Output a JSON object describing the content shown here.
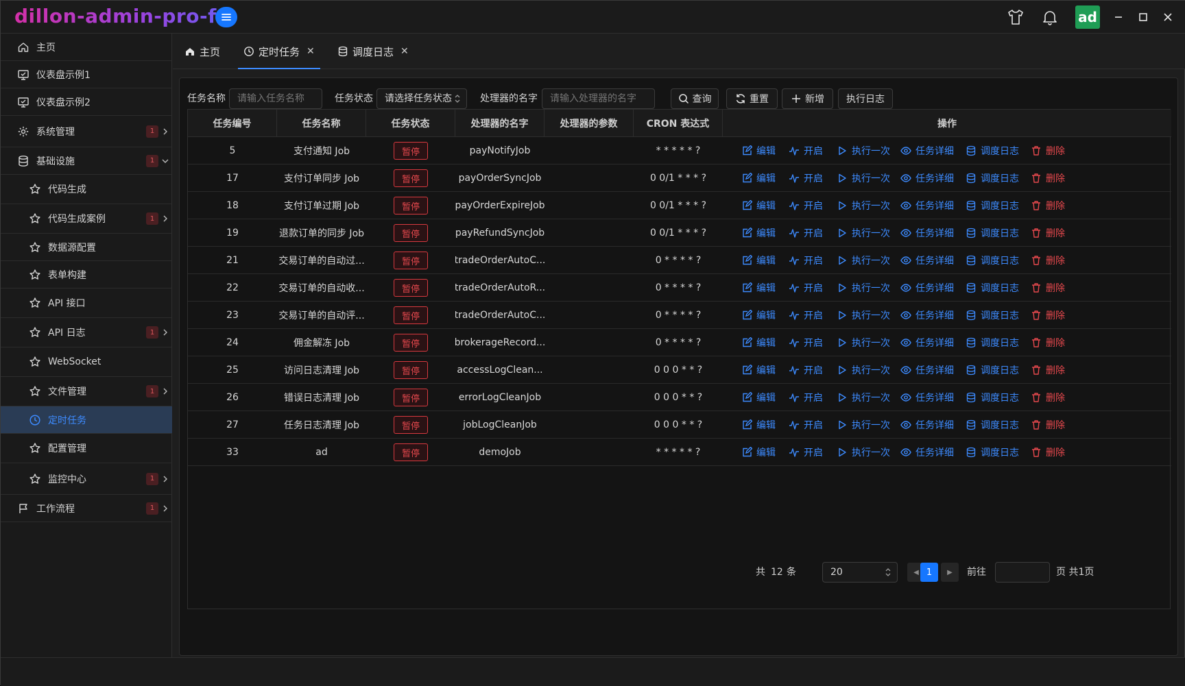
{
  "app": {
    "title": "dillon-admin-pro-fx",
    "avatar_text": "ad"
  },
  "icons": {
    "menu_toggle": "menu-icon",
    "theme": "shirt-icon",
    "notifications": "bell-icon",
    "minimize": "minimize-icon",
    "maximize": "maximize-icon",
    "close": "close-icon"
  },
  "sidebar": {
    "items": [
      {
        "label": "主页",
        "icon": "home-icon",
        "level": 1
      },
      {
        "label": "仪表盘示例1",
        "icon": "monitor-icon",
        "level": 1
      },
      {
        "label": "仪表盘示例2",
        "icon": "monitor-icon",
        "level": 1
      },
      {
        "label": "系统管理",
        "icon": "gear-icon",
        "level": 1,
        "badge": "1",
        "arrow": "right"
      },
      {
        "label": "基础设施",
        "icon": "database-icon",
        "level": 1,
        "badge": "1",
        "arrow": "down"
      },
      {
        "label": "代码生成",
        "icon": "star-icon",
        "level": 2
      },
      {
        "label": "代码生成案例",
        "icon": "star-icon",
        "level": 2,
        "badge": "1",
        "arrow": "right"
      },
      {
        "label": "数据源配置",
        "icon": "star-icon",
        "level": 2
      },
      {
        "label": "表单构建",
        "icon": "star-icon",
        "level": 2
      },
      {
        "label": "API 接口",
        "icon": "star-icon",
        "level": 2
      },
      {
        "label": "API 日志",
        "icon": "star-icon",
        "level": 2,
        "badge": "1",
        "arrow": "right"
      },
      {
        "label": "WebSocket",
        "icon": "star-icon",
        "level": 2
      },
      {
        "label": "文件管理",
        "icon": "star-icon",
        "level": 2,
        "badge": "1",
        "arrow": "right"
      },
      {
        "label": "定时任务",
        "icon": "clock-icon",
        "level": 2,
        "active": true
      },
      {
        "label": "配置管理",
        "icon": "star-icon",
        "level": 2
      },
      {
        "label": "监控中心",
        "icon": "star-icon",
        "level": 2,
        "badge": "1",
        "arrow": "right"
      },
      {
        "label": "工作流程",
        "icon": "flag-icon",
        "level": 1,
        "badge": "1",
        "arrow": "right"
      }
    ]
  },
  "tabs": [
    {
      "label": "主页",
      "icon": "home-icon",
      "closable": false
    },
    {
      "label": "定时任务",
      "icon": "clock-icon",
      "closable": true,
      "active": true
    },
    {
      "label": "调度日志",
      "icon": "database-icon",
      "closable": true
    }
  ],
  "filters": {
    "task_name_label": "任务名称",
    "task_name_placeholder": "请输入任务名称",
    "task_status_label": "任务状态",
    "task_status_value": "请选择任务状态",
    "handler_label": "处理器的名字",
    "handler_placeholder": "请输入处理器的名字",
    "search_label": "查询",
    "reset_label": "重置",
    "add_label": "新增",
    "exec_log_label": "执行日志"
  },
  "table": {
    "columns": [
      "任务编号",
      "任务名称",
      "任务状态",
      "处理器的名字",
      "处理器的参数",
      "CRON 表达式",
      "操作"
    ],
    "actions": [
      "编辑",
      "开启",
      "执行一次",
      "任务详细",
      "调度日志",
      "删除"
    ],
    "rows": [
      {
        "id": "5",
        "name": "支付通知 Job",
        "status": "暂停",
        "handler": "payNotifyJob",
        "params": "",
        "cron": "* * * * * ?"
      },
      {
        "id": "17",
        "name": "支付订单同步 Job",
        "status": "暂停",
        "handler": "payOrderSyncJob",
        "params": "",
        "cron": "0 0/1 * * * ?"
      },
      {
        "id": "18",
        "name": "支付订单过期 Job",
        "status": "暂停",
        "handler": "payOrderExpireJob",
        "params": "",
        "cron": "0 0/1 * * * ?"
      },
      {
        "id": "19",
        "name": "退款订单的同步 Job",
        "status": "暂停",
        "handler": "payRefundSyncJob",
        "params": "",
        "cron": "0 0/1 * * * ?"
      },
      {
        "id": "21",
        "name": "交易订单的自动过...",
        "status": "暂停",
        "handler": "tradeOrderAutoC...",
        "params": "",
        "cron": "0 * * * * ?"
      },
      {
        "id": "22",
        "name": "交易订单的自动收...",
        "status": "暂停",
        "handler": "tradeOrderAutoR...",
        "params": "",
        "cron": "0 * * * * ?"
      },
      {
        "id": "23",
        "name": "交易订单的自动评...",
        "status": "暂停",
        "handler": "tradeOrderAutoC...",
        "params": "",
        "cron": "0 * * * * ?"
      },
      {
        "id": "24",
        "name": "佣金解冻 Job",
        "status": "暂停",
        "handler": "brokerageRecord...",
        "params": "",
        "cron": "0 * * * * ?"
      },
      {
        "id": "25",
        "name": "访问日志清理 Job",
        "status": "暂停",
        "handler": "accessLogClean...",
        "params": "",
        "cron": "0 0 0 * * ?"
      },
      {
        "id": "26",
        "name": "错误日志清理 Job",
        "status": "暂停",
        "handler": "errorLogCleanJob",
        "params": "",
        "cron": "0 0 0 * * ?"
      },
      {
        "id": "27",
        "name": "任务日志清理 Job",
        "status": "暂停",
        "handler": "jobLogCleanJob",
        "params": "",
        "cron": "0 0 0 * * ?"
      },
      {
        "id": "33",
        "name": "ad",
        "status": "暂停",
        "handler": "demoJob",
        "params": "",
        "cron": "* * * * * ?"
      }
    ]
  },
  "pagination": {
    "total_prefix": "共",
    "total": "12",
    "total_suffix": "条",
    "page_size": "20",
    "current_page": "1",
    "goto_label": "前往",
    "pages_suffix": "页 共1页"
  },
  "colors": {
    "accent": "#1677ff",
    "link": "#3d8bff",
    "danger": "#e5484d",
    "avatar_bg": "#1f9d55"
  }
}
